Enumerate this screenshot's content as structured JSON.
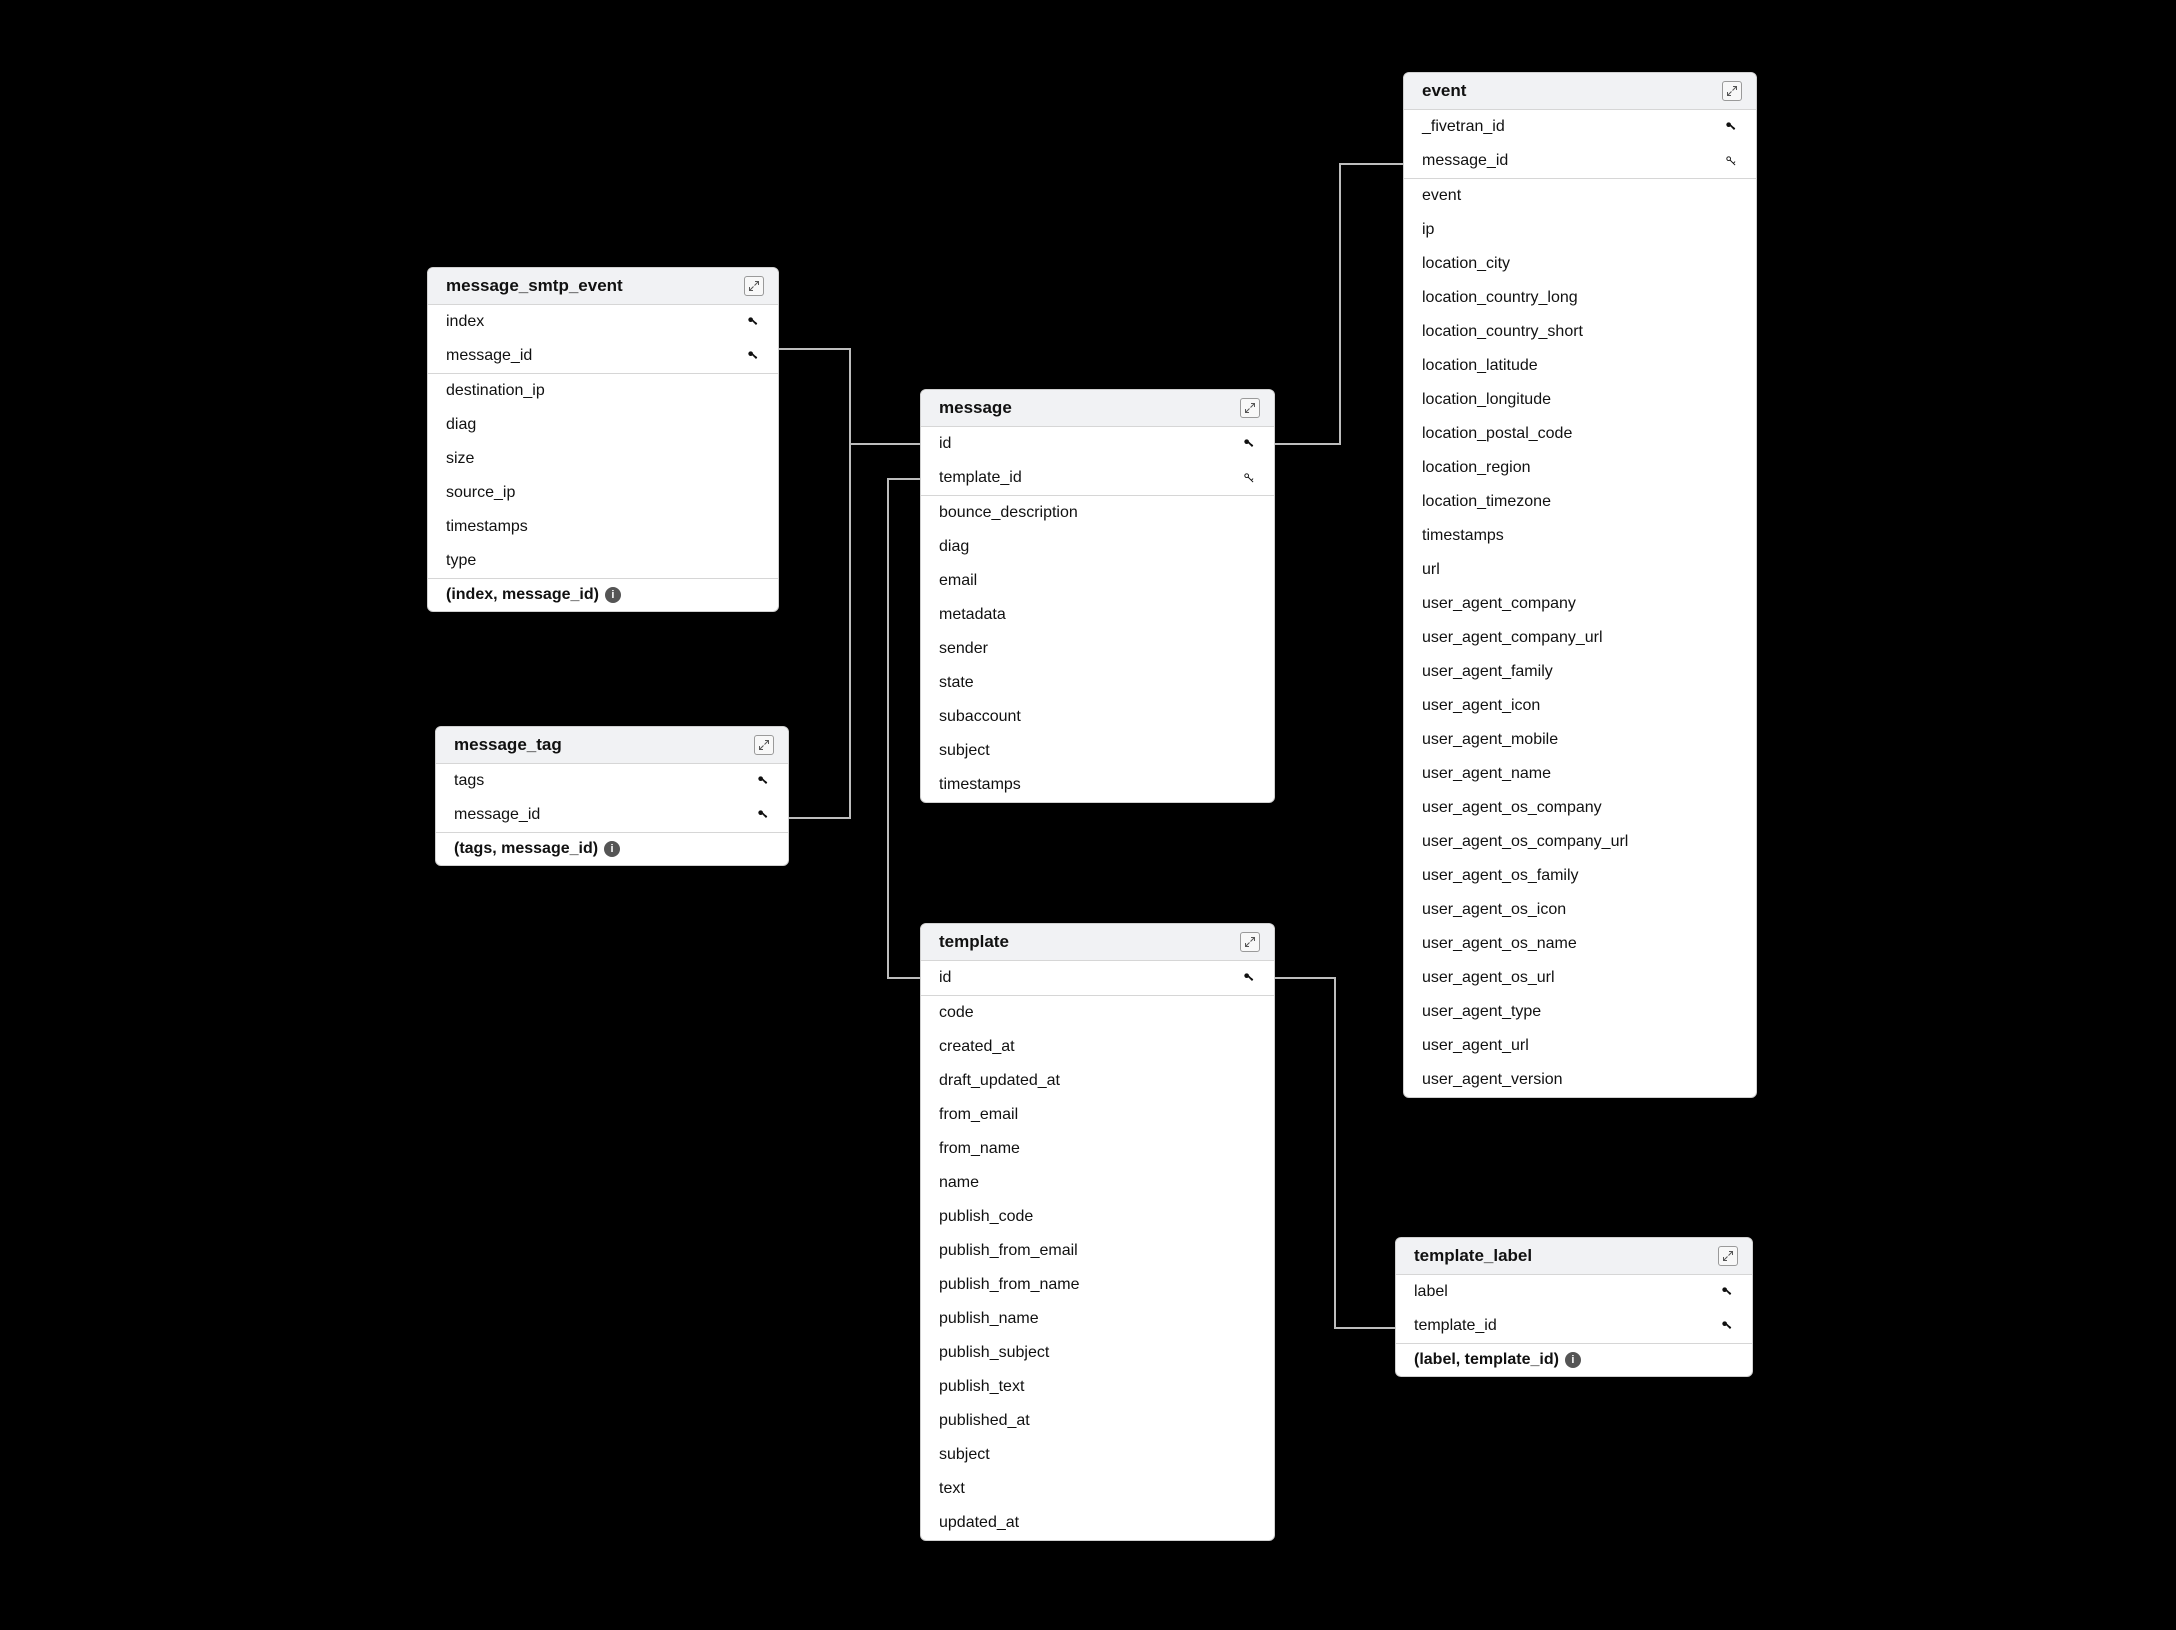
{
  "tables": {
    "message_smtp_event": {
      "title": "message_smtp_event",
      "fields": [
        {
          "name": "index",
          "key": "pk"
        },
        {
          "name": "message_id",
          "key": "pk"
        },
        {
          "name": "destination_ip"
        },
        {
          "name": "diag"
        },
        {
          "name": "size"
        },
        {
          "name": "source_ip"
        },
        {
          "name": "timestamps"
        },
        {
          "name": "type"
        }
      ],
      "composite": "(index, message_id)"
    },
    "message_tag": {
      "title": "message_tag",
      "fields": [
        {
          "name": "tags",
          "key": "pk"
        },
        {
          "name": "message_id",
          "key": "pk"
        }
      ],
      "composite": "(tags, message_id)"
    },
    "message": {
      "title": "message",
      "fields": [
        {
          "name": "id",
          "key": "pk"
        },
        {
          "name": "template_id",
          "key": "fk"
        },
        {
          "name": "bounce_description"
        },
        {
          "name": "diag"
        },
        {
          "name": "email"
        },
        {
          "name": "metadata"
        },
        {
          "name": "sender"
        },
        {
          "name": "state"
        },
        {
          "name": "subaccount"
        },
        {
          "name": "subject"
        },
        {
          "name": "timestamps"
        }
      ]
    },
    "template": {
      "title": "template",
      "fields": [
        {
          "name": "id",
          "key": "pk"
        },
        {
          "name": "code"
        },
        {
          "name": "created_at"
        },
        {
          "name": "draft_updated_at"
        },
        {
          "name": "from_email"
        },
        {
          "name": "from_name"
        },
        {
          "name": "name"
        },
        {
          "name": "publish_code"
        },
        {
          "name": "publish_from_email"
        },
        {
          "name": "publish_from_name"
        },
        {
          "name": "publish_name"
        },
        {
          "name": "publish_subject"
        },
        {
          "name": "publish_text"
        },
        {
          "name": "published_at"
        },
        {
          "name": "subject"
        },
        {
          "name": "text"
        },
        {
          "name": "updated_at"
        }
      ]
    },
    "event": {
      "title": "event",
      "fields": [
        {
          "name": "_fivetran_id",
          "key": "pk"
        },
        {
          "name": "message_id",
          "key": "fk"
        },
        {
          "name": "event"
        },
        {
          "name": "ip"
        },
        {
          "name": "location_city"
        },
        {
          "name": "location_country_long"
        },
        {
          "name": "location_country_short"
        },
        {
          "name": "location_latitude"
        },
        {
          "name": "location_longitude"
        },
        {
          "name": "location_postal_code"
        },
        {
          "name": "location_region"
        },
        {
          "name": "location_timezone"
        },
        {
          "name": "timestamps"
        },
        {
          "name": "url"
        },
        {
          "name": "user_agent_company"
        },
        {
          "name": "user_agent_company_url"
        },
        {
          "name": "user_agent_family"
        },
        {
          "name": "user_agent_icon"
        },
        {
          "name": "user_agent_mobile"
        },
        {
          "name": "user_agent_name"
        },
        {
          "name": "user_agent_os_company"
        },
        {
          "name": "user_agent_os_company_url"
        },
        {
          "name": "user_agent_os_family"
        },
        {
          "name": "user_agent_os_icon"
        },
        {
          "name": "user_agent_os_name"
        },
        {
          "name": "user_agent_os_url"
        },
        {
          "name": "user_agent_type"
        },
        {
          "name": "user_agent_url"
        },
        {
          "name": "user_agent_version"
        }
      ]
    },
    "template_label": {
      "title": "template_label",
      "fields": [
        {
          "name": "label",
          "key": "pk"
        },
        {
          "name": "template_id",
          "key": "pk"
        }
      ],
      "composite": "(label, template_id)"
    }
  },
  "connectors": [
    {
      "from": "message_smtp_event.message_id",
      "to": "message.id"
    },
    {
      "from": "message_tag.message_id",
      "to": "message.id"
    },
    {
      "from": "event.message_id",
      "to": "message.id"
    },
    {
      "from": "message.template_id",
      "to": "template.id"
    },
    {
      "from": "template_label.template_id",
      "to": "template.id"
    }
  ],
  "icon_names": {
    "expand": "expand-icon",
    "pk": "primary-key-icon",
    "fk": "foreign-key-icon",
    "info": "info-icon"
  }
}
